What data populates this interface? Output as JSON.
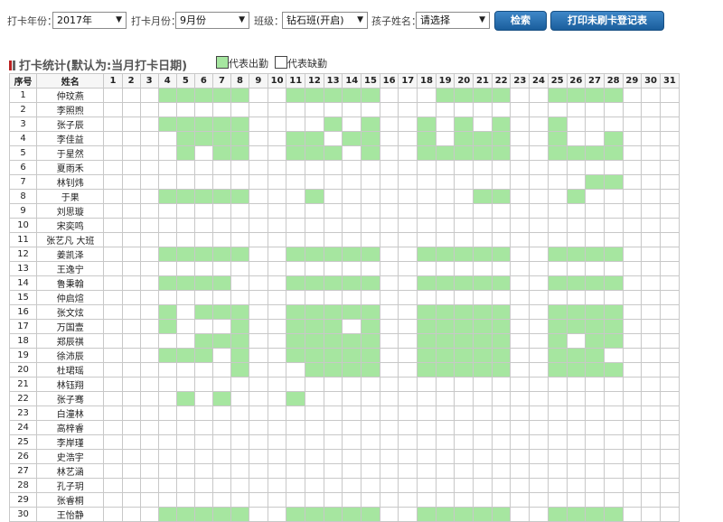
{
  "filters": {
    "year_label": "打卡年份：",
    "year_value": "2017年",
    "month_label": "打卡月份：",
    "month_value": "9月份",
    "class_label": "班级：",
    "class_value": "钻石班(开启)",
    "child_label": "孩子姓名：",
    "child_value": "请选择",
    "search_button": "检索",
    "print_button": "打印未刷卡登记表"
  },
  "section_title": "打卡统计(默认为:当月打卡日期)",
  "legend": {
    "present": "代表出勤",
    "absent": "代表缺勤"
  },
  "colors": {
    "present": "#a6e6a0",
    "button": "#1f67a8"
  },
  "table": {
    "col_no": "序号",
    "col_name": "姓名",
    "days": [
      "1",
      "2",
      "3",
      "4",
      "5",
      "6",
      "7",
      "8",
      "9",
      "10",
      "11",
      "12",
      "13",
      "14",
      "15",
      "16",
      "17",
      "18",
      "19",
      "20",
      "21",
      "22",
      "23",
      "24",
      "25",
      "26",
      "27",
      "28",
      "29",
      "30",
      "31"
    ],
    "rows": [
      {
        "no": "1",
        "name": "仲玟燕",
        "present": [
          4,
          5,
          6,
          7,
          8,
          11,
          12,
          13,
          14,
          15,
          19,
          20,
          21,
          22,
          25,
          26,
          27,
          28
        ]
      },
      {
        "no": "2",
        "name": "李照煦",
        "present": []
      },
      {
        "no": "3",
        "name": "张子辰",
        "present": [
          4,
          5,
          6,
          7,
          8,
          13,
          15,
          18,
          20,
          22,
          25
        ]
      },
      {
        "no": "4",
        "name": "李佳益",
        "present": [
          5,
          6,
          7,
          8,
          11,
          12,
          14,
          15,
          18,
          20,
          21,
          22,
          25,
          28
        ]
      },
      {
        "no": "5",
        "name": "于星然",
        "present": [
          5,
          7,
          8,
          11,
          12,
          13,
          15,
          18,
          19,
          20,
          21,
          22,
          25,
          26,
          27,
          28
        ]
      },
      {
        "no": "6",
        "name": "夏雨禾",
        "present": []
      },
      {
        "no": "7",
        "name": "林钊炜",
        "present": [
          27,
          28
        ]
      },
      {
        "no": "8",
        "name": "于果",
        "present": [
          4,
          5,
          6,
          7,
          8,
          12,
          21,
          22,
          26
        ]
      },
      {
        "no": "9",
        "name": "刘思璇",
        "present": []
      },
      {
        "no": "10",
        "name": "宋奕鸣",
        "present": []
      },
      {
        "no": "11",
        "name": "张艺凡 大班",
        "present": []
      },
      {
        "no": "12",
        "name": "姜凯泽",
        "present": [
          4,
          5,
          6,
          7,
          8,
          11,
          12,
          13,
          14,
          15,
          18,
          19,
          20,
          21,
          22,
          25,
          26,
          27,
          28
        ]
      },
      {
        "no": "13",
        "name": "王逸宁",
        "present": []
      },
      {
        "no": "14",
        "name": "鲁秉翰",
        "present": [
          4,
          5,
          6,
          7,
          11,
          12,
          13,
          14,
          15,
          18,
          19,
          20,
          21,
          22,
          25,
          26,
          27,
          28
        ]
      },
      {
        "no": "15",
        "name": "仲启煊",
        "present": []
      },
      {
        "no": "16",
        "name": "张文炫",
        "present": [
          4,
          6,
          7,
          8,
          11,
          12,
          13,
          14,
          15,
          18,
          19,
          20,
          21,
          22,
          25,
          26,
          27,
          28
        ]
      },
      {
        "no": "17",
        "name": "万国壹",
        "present": [
          4,
          8,
          11,
          12,
          13,
          15,
          18,
          19,
          20,
          21,
          22,
          25,
          26,
          27,
          28
        ]
      },
      {
        "no": "18",
        "name": "郑辰祺",
        "present": [
          6,
          7,
          8,
          11,
          12,
          13,
          14,
          15,
          18,
          19,
          20,
          21,
          22,
          25,
          27,
          28
        ]
      },
      {
        "no": "19",
        "name": "徐沛辰",
        "present": [
          4,
          5,
          6,
          8,
          11,
          12,
          13,
          14,
          15,
          18,
          19,
          20,
          21,
          22,
          25,
          26,
          27
        ]
      },
      {
        "no": "20",
        "name": "杜珺瑶",
        "present": [
          8,
          12,
          13,
          14,
          15,
          18,
          19,
          20,
          21,
          22,
          25,
          26,
          27,
          28
        ]
      },
      {
        "no": "21",
        "name": "林钰翔",
        "present": []
      },
      {
        "no": "22",
        "name": "张子骞",
        "present": [
          5,
          7,
          11
        ]
      },
      {
        "no": "23",
        "name": "白潼林",
        "present": []
      },
      {
        "no": "24",
        "name": "高梓睿",
        "present": []
      },
      {
        "no": "25",
        "name": "李岸瑾",
        "present": []
      },
      {
        "no": "26",
        "name": "史浩宇",
        "present": []
      },
      {
        "no": "27",
        "name": "林艺涵",
        "present": []
      },
      {
        "no": "28",
        "name": "孔子玥",
        "present": []
      },
      {
        "no": "29",
        "name": "张睿桐",
        "present": []
      },
      {
        "no": "30",
        "name": "王怡静",
        "present": [
          4,
          5,
          6,
          7,
          8,
          11,
          12,
          13,
          14,
          15,
          18,
          19,
          20,
          21,
          22,
          25,
          26,
          27,
          28
        ]
      }
    ]
  }
}
